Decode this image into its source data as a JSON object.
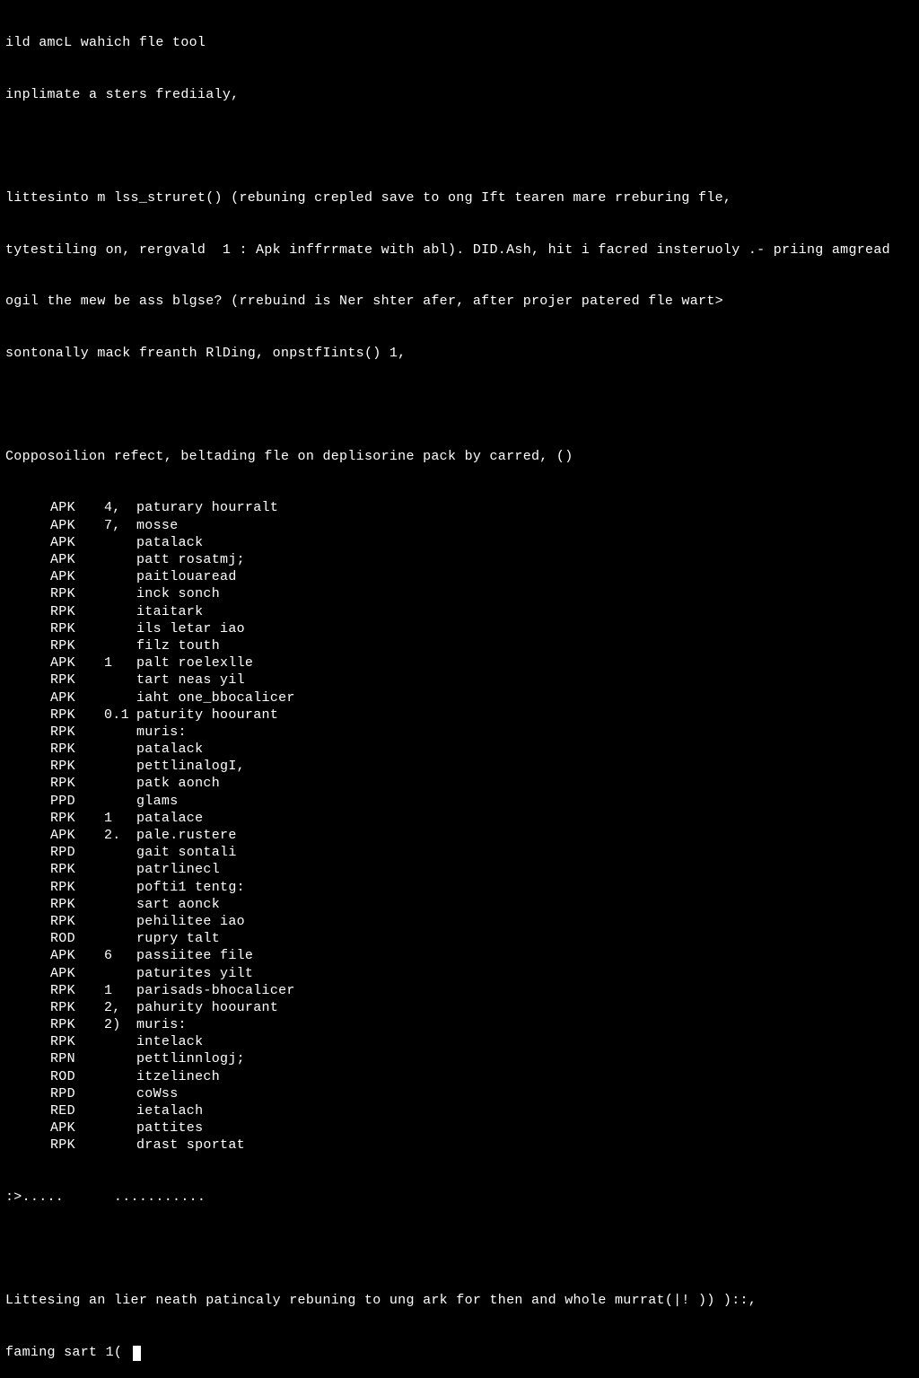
{
  "header": {
    "line1": "ild amcL wahich fle tool",
    "line2": "inplimate a sters frediialy,"
  },
  "block1": {
    "line1": "littesinto m lss_struret() (rebuning crepled save to ong Ift tearen mare rreburing fle,",
    "line2": "tytestiling on, rergvald  1 : Apk inffrrmate with abl). DID.Ash, hit i facred insteruoly .- priing amgread",
    "line3": "ogil the mew be ass blgse? (rrebuind is Ner shter afer, after projer patered fle wart>",
    "line4": "sontonally mack freanth RlDing, onpstfIints() 1,"
  },
  "section_header": "Copposoilion refect, beltading fle on deplisorine pack by carred, ()",
  "rows": [
    {
      "type": "APK",
      "num": "4,",
      "desc": "paturary hourralt"
    },
    {
      "type": "APK",
      "num": "7,",
      "desc": "mosse"
    },
    {
      "type": "APK",
      "num": "",
      "desc": "patalack"
    },
    {
      "type": "APK",
      "num": "",
      "desc": "patt rosatmj;"
    },
    {
      "type": "APK",
      "num": "",
      "desc": "paitlouaread"
    },
    {
      "type": "RPK",
      "num": "",
      "desc": "inck sonch"
    },
    {
      "type": "RPK",
      "num": "",
      "desc": "itaitark"
    },
    {
      "type": "RPK",
      "num": "",
      "desc": "ils letar iao"
    },
    {
      "type": "RPK",
      "num": "",
      "desc": "filz touth"
    },
    {
      "type": "APK",
      "num": "1",
      "desc": "palt roelexlle"
    },
    {
      "type": "RPK",
      "num": "",
      "desc": "tart neas yil"
    },
    {
      "type": "APK",
      "num": "",
      "desc": "iaht one_bbocalicer"
    },
    {
      "type": "RPK",
      "num": "0.1",
      "desc": "paturity hoourant"
    },
    {
      "type": "RPK",
      "num": "",
      "desc": "muris:"
    },
    {
      "type": "RPK",
      "num": "",
      "desc": "patalack"
    },
    {
      "type": "RPK",
      "num": "",
      "desc": "pettlinalogI,"
    },
    {
      "type": "RPK",
      "num": "",
      "desc": "patk aonch"
    },
    {
      "type": "PPD",
      "num": "",
      "desc": "glams"
    },
    {
      "type": "RPK",
      "num": "1",
      "desc": "patalace"
    },
    {
      "type": "APK",
      "num": "2.",
      "desc": "pale.rustere"
    },
    {
      "type": "RPD",
      "num": "",
      "desc": "gait sontali"
    },
    {
      "type": "RPK",
      "num": "",
      "desc": "patrlinecl"
    },
    {
      "type": "RPK",
      "num": "",
      "desc": "pofti1 tentg:"
    },
    {
      "type": "RPK",
      "num": "",
      "desc": "sart aonck"
    },
    {
      "type": "RPK",
      "num": "",
      "desc": "pehilitee iao"
    },
    {
      "type": "ROD",
      "num": "",
      "desc": "rupry talt"
    },
    {
      "type": "APK",
      "num": "6",
      "desc": "passiitee file"
    },
    {
      "type": "APK",
      "num": "",
      "desc": "paturites yilt"
    },
    {
      "type": "RPK",
      "num": "1",
      "desc": "parisads-bhocalicer"
    },
    {
      "type": "RPK",
      "num": "2,",
      "desc": "pahurity hoourant"
    },
    {
      "type": "RPK",
      "num": "2)",
      "desc": "muris:"
    },
    {
      "type": "RPK",
      "num": "",
      "desc": "intelack"
    },
    {
      "type": "RPN",
      "num": "",
      "desc": "pettlinnlogj;"
    },
    {
      "type": "ROD",
      "num": "",
      "desc": "itzelinech"
    },
    {
      "type": "RPD",
      "num": "",
      "desc": "coWss"
    },
    {
      "type": "RED",
      "num": "",
      "desc": "ietalach"
    },
    {
      "type": "APK",
      "num": "",
      "desc": "pattites"
    },
    {
      "type": "RPK",
      "num": "",
      "desc": "drast sportat"
    }
  ],
  "ellipsis": ":>.....      ...........",
  "footer": {
    "line1": "Littesing an lier neath patincaly rebuning to ung ark for then and whole murrat(|! )) )::,",
    "prompt": "faming sart 1( "
  }
}
